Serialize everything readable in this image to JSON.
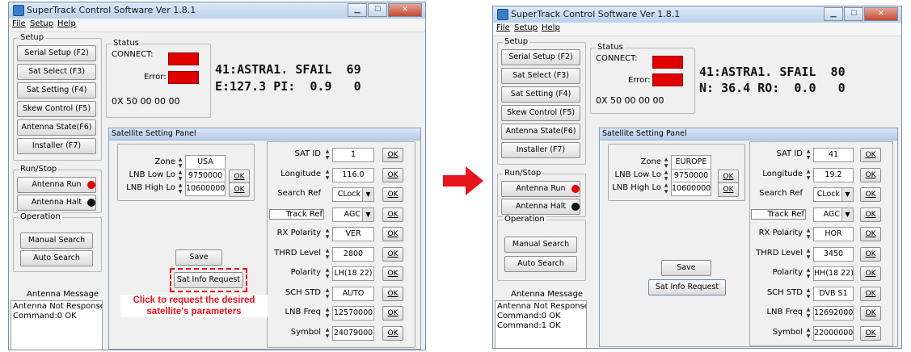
{
  "left": {
    "title": "SuperTrack Control Software Ver 1.8.1",
    "menu": [
      "File",
      "Setup",
      "Help"
    ],
    "setup": {
      "label": "Setup",
      "buttons": [
        "Serial Setup (F2)",
        "Sat Select  (F3)",
        "Sat Setting  (F4)",
        "Skew Control (F5)",
        "Antenna State(F6)",
        "Installer    (F7)"
      ]
    },
    "status": {
      "label": "Status",
      "connect": "CONNECT:",
      "error": "Error:",
      "hex": "0X 50 00 00 00"
    },
    "display": {
      "line1": "41:ASTRA1. SFAIL  69",
      "line2": "E:127.3 PI:  0.9   0"
    },
    "runstop": {
      "label": "Run/Stop",
      "run": "Antenna Run",
      "halt": "Antenna Halt"
    },
    "operation": {
      "label": "Operation",
      "manual": "Manual Search",
      "auto": "Auto Search"
    },
    "antenna_message": "Antenna Message",
    "messages": [
      "Antenna Not Response",
      "Command:0 OK"
    ],
    "panel": {
      "title": "Satellite Setting Panel",
      "zone_label": "Zone",
      "zone": "USA",
      "lnb_low_label": "LNB Low Lo",
      "lnb_low": "9750000",
      "lnb_high_label": "LNB High Lo",
      "lnb_high": "10600000",
      "ok": "OK",
      "save": "Save",
      "sat_info": "Sat Info Request",
      "fields": [
        {
          "label": "SAT ID",
          "value": "1"
        },
        {
          "label": "Longitude",
          "value": "116.0"
        },
        {
          "label": "Search Ref",
          "value": "CLock"
        },
        {
          "label": "Track Ref",
          "value": "AGC"
        },
        {
          "label": "RX Polarity",
          "value": "VER"
        },
        {
          "label": "THRD Level",
          "value": "2800"
        },
        {
          "label": "Polarity",
          "value": "LH(18 22)"
        },
        {
          "label": "SCH STD",
          "value": "AUTO"
        },
        {
          "label": "LNB Freq",
          "value": "12570000"
        },
        {
          "label": "Symbol",
          "value": "24079000"
        }
      ],
      "callout": "Click to request the desired satellite's parameters"
    }
  },
  "right": {
    "title": "SuperTrack Control Software Ver 1.8.1",
    "menu": [
      "File",
      "Setup",
      "Help"
    ],
    "setup": {
      "label": "Setup",
      "buttons": [
        "Serial Setup (F2)",
        "Sat Select  (F3)",
        "Sat Setting  (F4)",
        "Skew Control (F5)",
        "Antenna State(F6)",
        "Installer    (F7)"
      ]
    },
    "status": {
      "label": "Status",
      "connect": "CONNECT:",
      "error": "Error:",
      "hex": "0X 50 00 00 00"
    },
    "display": {
      "line1": "41:ASTRA1. SFAIL  80",
      "line2": "N: 36.4 RO:  0.0   0"
    },
    "runstop": {
      "label": "Run/Stop",
      "run": "Antenna Run",
      "halt": "Antenna Halt"
    },
    "operation": {
      "label": "Operation",
      "manual": "Manual Search",
      "auto": "Auto Search"
    },
    "antenna_message": "Antenna Message",
    "messages": [
      "Antenna Not Response",
      "Command:0 OK",
      "Command:1 OK"
    ],
    "panel": {
      "title": "Satellite Setting Panel",
      "zone_label": "Zone",
      "zone": "EUROPE",
      "lnb_low_label": "LNB Low Lo",
      "lnb_low": "9750000",
      "lnb_high_label": "LNB High Lo",
      "lnb_high": "10600000",
      "ok": "OK",
      "save": "Save",
      "sat_info": "Sat Info Request",
      "fields": [
        {
          "label": "SAT ID",
          "value": "41"
        },
        {
          "label": "Longitude",
          "value": "19.2"
        },
        {
          "label": "Search Ref",
          "value": "CLock"
        },
        {
          "label": "Track Ref",
          "value": "AGC"
        },
        {
          "label": "RX Polarity",
          "value": "HOR"
        },
        {
          "label": "THRD Level",
          "value": "3450"
        },
        {
          "label": "Polarity",
          "value": "HH(18 22)"
        },
        {
          "label": "SCH STD",
          "value": "DVB S1"
        },
        {
          "label": "LNB Freq",
          "value": "12692000"
        },
        {
          "label": "Symbol",
          "value": "22000000"
        }
      ]
    }
  },
  "colors": {
    "led_red": "#e00000",
    "arrow": "#e8141c",
    "callout": "#e8141c"
  }
}
